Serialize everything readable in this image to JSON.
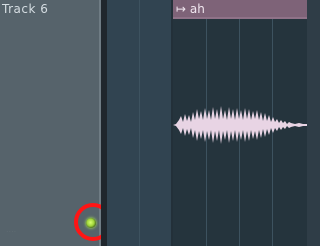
{
  "track": {
    "name": "Track 6",
    "footer_text": "...."
  },
  "clip": {
    "name": "ah",
    "arrow_glyph": "↦",
    "color": "#7e6378"
  },
  "icons": {
    "track_led": "record-led-icon"
  },
  "annotation": {
    "circle_color": "#ff1515"
  }
}
